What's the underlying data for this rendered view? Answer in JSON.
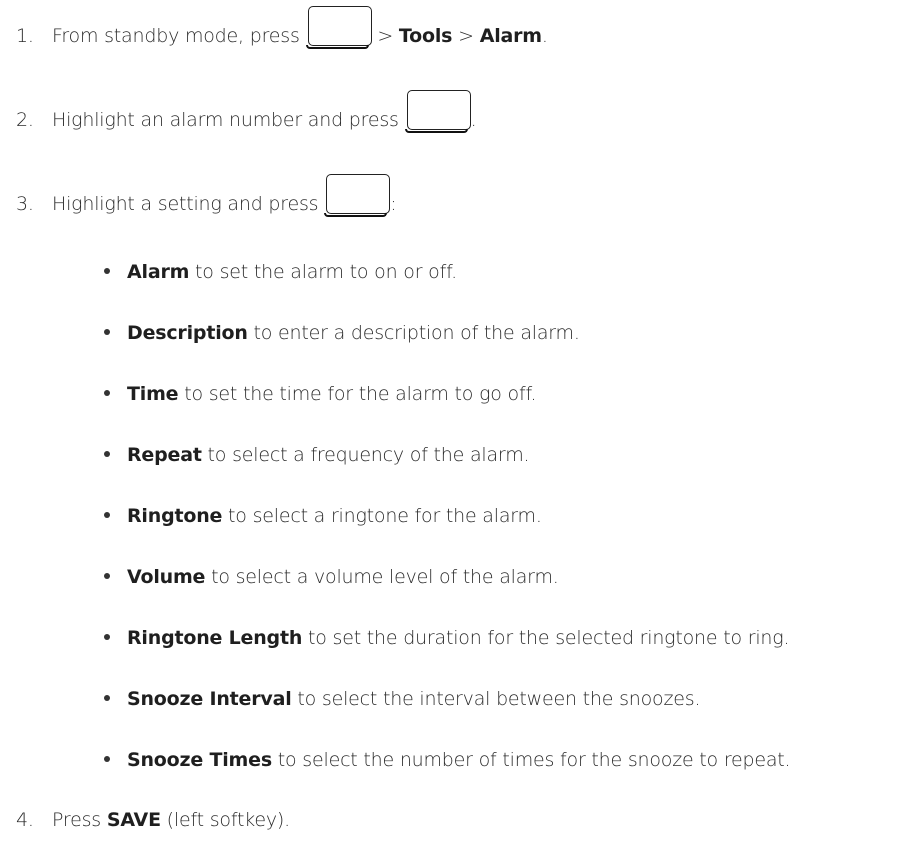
{
  "steps": [
    {
      "number": "1.",
      "text_before": "From standby mode, press ",
      "key_icon": "menu-key-icon",
      "text_after": " > ",
      "bold_1": "Tools",
      "sep": " > ",
      "bold_2": "Alarm",
      "end": "."
    },
    {
      "number": "2.",
      "text_before": "Highlight an alarm number and press ",
      "key_icon": "ok-key-icon",
      "end": "."
    },
    {
      "number": "3.",
      "text_before": "Highlight a setting and press ",
      "key_icon": "ok-key-icon",
      "end": ":"
    },
    {
      "number": "4.",
      "text_before": "Press ",
      "bold": "SAVE",
      "end": " (left softkey)."
    }
  ],
  "settings": [
    {
      "term": "Alarm",
      "desc": " to set the alarm to on or off."
    },
    {
      "term": "Description",
      "desc": " to enter a description of the alarm."
    },
    {
      "term": "Time",
      "desc": " to set the time for the alarm to go off."
    },
    {
      "term": "Repeat",
      "desc": " to select a frequency of the alarm."
    },
    {
      "term": "Ringtone",
      "desc": " to select a ringtone for the alarm."
    },
    {
      "term": "Volume",
      "desc": " to select a volume level of the alarm."
    },
    {
      "term": "Ringtone Length",
      "desc": " to set the duration for the selected ringtone to ring."
    },
    {
      "term": "Snooze Interval",
      "desc": " to select the interval between the snoozes."
    },
    {
      "term": "Snooze Times",
      "desc": " to select the number of times for the snooze to repeat."
    }
  ]
}
